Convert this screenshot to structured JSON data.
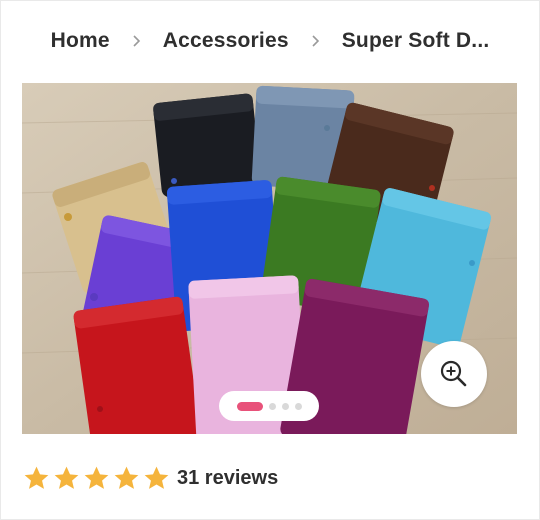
{
  "breadcrumb": {
    "items": [
      "Home",
      "Accessories",
      "Super Soft D..."
    ]
  },
  "gallery": {
    "image_subject": "colorful velvet drawstring pouches",
    "slide_count": 4,
    "active_slide": 1,
    "zoom_icon": "zoom-in-icon"
  },
  "rating": {
    "stars": 5,
    "reviews_label": "31 reviews"
  },
  "colors": {
    "star": "#F5B43C",
    "pager_active": "#E8527A",
    "text": "#2F2F2F"
  }
}
